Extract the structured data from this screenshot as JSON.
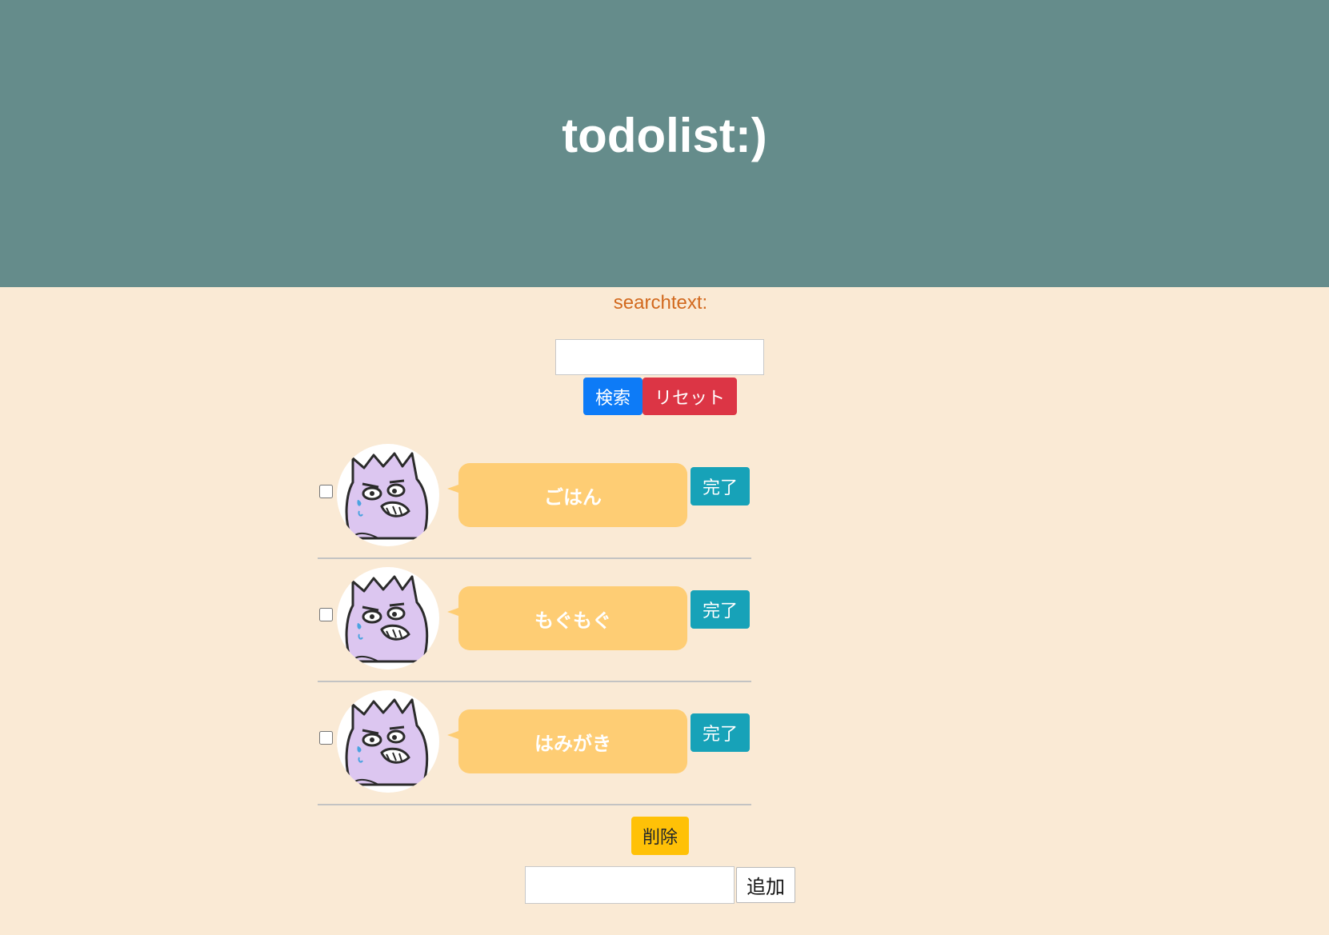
{
  "header": {
    "title": "todolist:)"
  },
  "search": {
    "label": "searchtext:",
    "value": "",
    "search_button": "検索",
    "reset_button": "リセット"
  },
  "todos": [
    {
      "text": "ごはん",
      "done_label": "完了",
      "checked": false
    },
    {
      "text": "もぐもぐ",
      "done_label": "完了",
      "checked": false
    },
    {
      "text": "はみがき",
      "done_label": "完了",
      "checked": false
    }
  ],
  "footer": {
    "delete_button": "削除",
    "add_value": "",
    "add_button": "追加"
  },
  "colors": {
    "header_bg": "#658c8b",
    "page_bg": "#faead5",
    "bubble": "#fecd74",
    "search_btn": "#0d7bf7",
    "reset_btn": "#dc3545",
    "done_btn": "#17a2b8",
    "delete_btn": "#ffc107",
    "label_text": "#d2691e"
  },
  "avatar_icon": "purple-cat-monster-avatar"
}
